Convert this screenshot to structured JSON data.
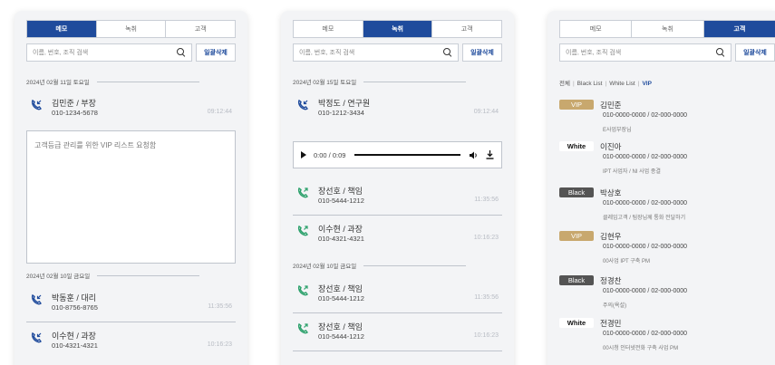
{
  "tabs": {
    "memo": "메모",
    "record": "녹취",
    "customer": "고객"
  },
  "search": {
    "placeholder": "이름, 번호, 조직 검색",
    "delete_all": "일괄삭제"
  },
  "panel1": {
    "date1": "2024년 02월 11일 토요일",
    "call1": {
      "name": "김민준 / 부장",
      "number": "010-1234-5678",
      "time": "09:12:44"
    },
    "memo_text": "고객등급 관리를 위한 VIP 리스트 요청함",
    "date2": "2024년 02월 10일 금요일",
    "call2": {
      "name": "박동훈 / 대리",
      "number": "010-8756-8765",
      "time": "11:35:56"
    },
    "call3": {
      "name": "이수현 / 과장",
      "number": "010-4321-4321",
      "time": "10:16:23"
    }
  },
  "panel2": {
    "date1": "2024년 02월 15일 토요일",
    "call1": {
      "name": "박정도 / 연구원",
      "number": "010-1212-3434",
      "time": "09:12:44"
    },
    "player": {
      "time": "0:00 / 0:09"
    },
    "call2": {
      "name": "장선호 / 책임",
      "number": "010-5444-1212",
      "time": "11:35:56"
    },
    "call3": {
      "name": "이수현 / 과장",
      "number": "010-4321-4321",
      "time": "10:16:23"
    },
    "date2": "2024년 02월 10일 금요일",
    "call4": {
      "name": "장선호 / 책임",
      "number": "010-5444-1212",
      "time": "11:35:56"
    },
    "call5": {
      "name": "장선호 / 책임",
      "number": "010-5444-1212",
      "time": "10:16:23"
    }
  },
  "panel3": {
    "filters": {
      "all": "전체",
      "black": "Black List",
      "white": "White List",
      "vip": "VIP"
    },
    "items": [
      {
        "badge": "VIP",
        "name": "김민준",
        "phones": "010-0000-0000 / 02-000-0000",
        "note": "E사업부장님"
      },
      {
        "badge": "White",
        "name": "이진아",
        "phones": "010-0000-0000 / 02-000-0000",
        "note": "IPT 사업자 / NI 사업 종결"
      },
      {
        "badge": "Black",
        "name": "박상호",
        "phones": "010-0000-0000 / 02-000-0000",
        "note": "클레임고객 / 팀장님께 통화 전달하기"
      },
      {
        "badge": "VIP",
        "name": "김현우",
        "phones": "010-0000-0000 / 02-000-0000",
        "note": "00사업 IPT 구축 PM"
      },
      {
        "badge": "Black",
        "name": "정경찬",
        "phones": "010-0000-0000 / 02-000-0000",
        "note": "주의(욕설)"
      },
      {
        "badge": "White",
        "name": "전경민",
        "phones": "010-0000-0000 / 02-000-0000",
        "note": "00시청 인터넷전화 구축 사업 PM"
      }
    ]
  },
  "colors": {
    "accent": "#1f4b9c",
    "call_in": "#1f4b9c",
    "call_out": "#2aa06a",
    "vip": "#c8a86e",
    "black": "#545454"
  }
}
